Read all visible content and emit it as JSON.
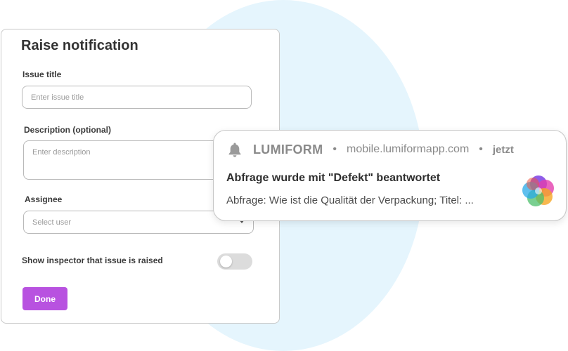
{
  "form": {
    "title": "Raise notification",
    "issue_title": {
      "label": "Issue title",
      "placeholder": "Enter issue title"
    },
    "description": {
      "label": "Description (optional)",
      "placeholder": "Enter description"
    },
    "assignee": {
      "label": "Assignee",
      "placeholder": "Select user"
    },
    "show_inspector": {
      "label": "Show inspector that issue is raised",
      "enabled": false
    },
    "done_label": "Done"
  },
  "notification": {
    "app_name": "LUMIFORM",
    "separator": "•",
    "domain": "mobile.lumiformapp.com",
    "time": "jetzt",
    "title": "Abfrage wurde mit \"Defekt\" beantwortet",
    "body": "Abfrage: Wie ist die Qualität der Verpackung; Titel: ...",
    "icons": {
      "bell": "bell-icon",
      "logo": "lumiform-logo"
    }
  },
  "colors": {
    "accent": "#b852e0",
    "background_circle": "#e5f5fd",
    "logo_colors": [
      "#7b3fe4",
      "#e33fae",
      "#f05540",
      "#f6a623",
      "#4cbf6b",
      "#29a9e8"
    ]
  }
}
